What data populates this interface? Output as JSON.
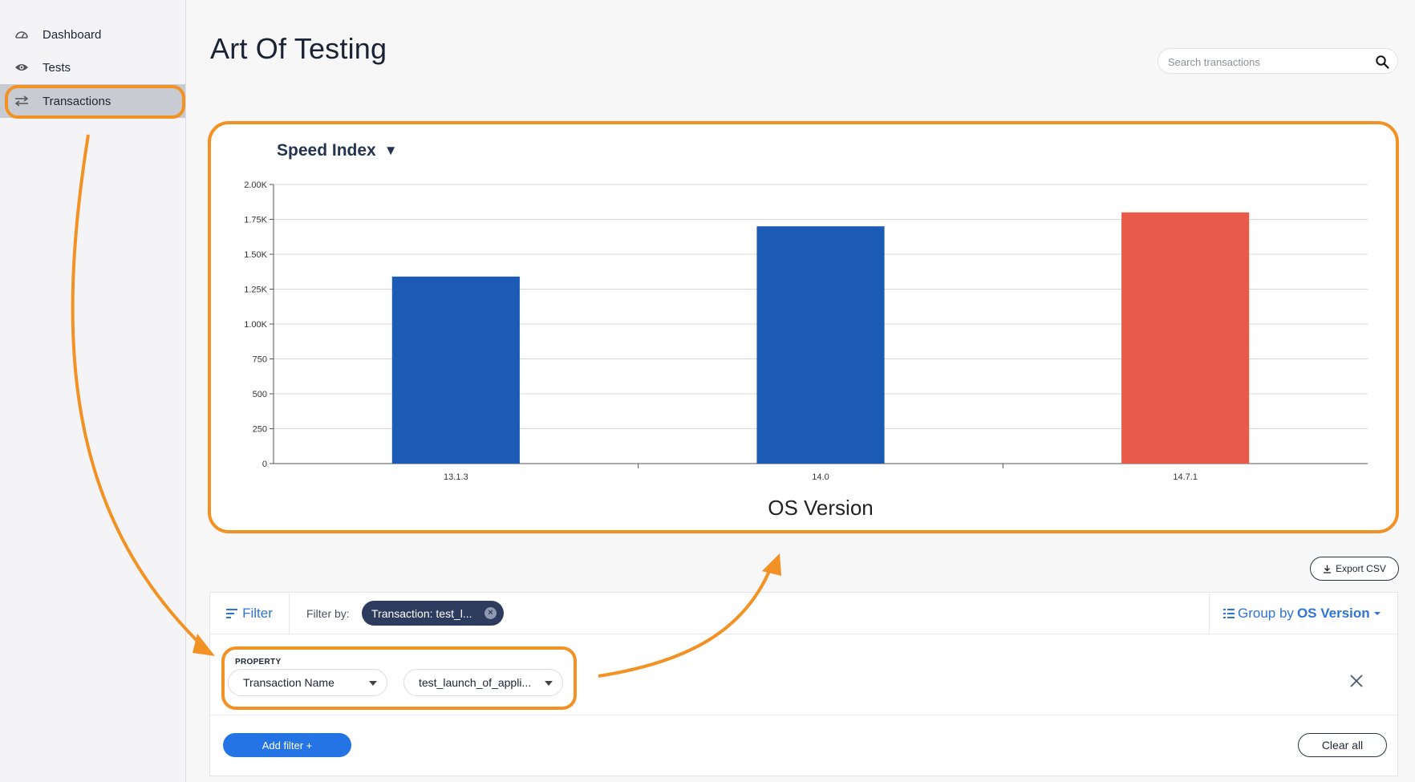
{
  "sidebar": {
    "items": [
      {
        "label": "Dashboard",
        "icon": "speedometer-icon"
      },
      {
        "label": "Tests",
        "icon": "eye-icon"
      },
      {
        "label": "Transactions",
        "icon": "swap-arrows-icon",
        "active": true
      }
    ]
  },
  "header": {
    "title": "Art Of Testing",
    "search_placeholder": "Search transactions"
  },
  "chart": {
    "metric_label": "Speed Index",
    "metric_caret": "▼"
  },
  "chart_data": {
    "type": "bar",
    "categories": [
      "13.1.3",
      "14.0",
      "14.7.1"
    ],
    "values": [
      1340,
      1700,
      1800
    ],
    "bar_colors": [
      "#1b5ab5",
      "#1b5ab5",
      "#e85a4a"
    ],
    "xlabel": "OS Version",
    "ylabel": "",
    "ylim": [
      0,
      2000
    ],
    "yticks": [
      0,
      250,
      500,
      750,
      1000,
      1250,
      1500,
      1750,
      2000
    ],
    "ytick_labels": [
      "0",
      "250",
      "500",
      "750",
      "1.00K",
      "1.25K",
      "1.50K",
      "1.75K",
      "2.00K"
    ],
    "grid": true
  },
  "export": {
    "label": "Export CSV"
  },
  "filter": {
    "tab_label": "Filter",
    "filter_by_label": "Filter by:",
    "chip_label": "Transaction: test_l...",
    "group_by_prefix": "Group by",
    "group_by_value": "OS Version",
    "property_label": "PROPERTY",
    "property_value": "Transaction Name",
    "value_value": "test_launch_of_appli...",
    "add_filter_label": "Add filter +",
    "clear_all_label": "Clear all"
  },
  "colors": {
    "accent": "#2474e6",
    "highlight": "#f39224",
    "bar_primary": "#1b5ab5",
    "bar_highlight": "#e85a4a"
  }
}
